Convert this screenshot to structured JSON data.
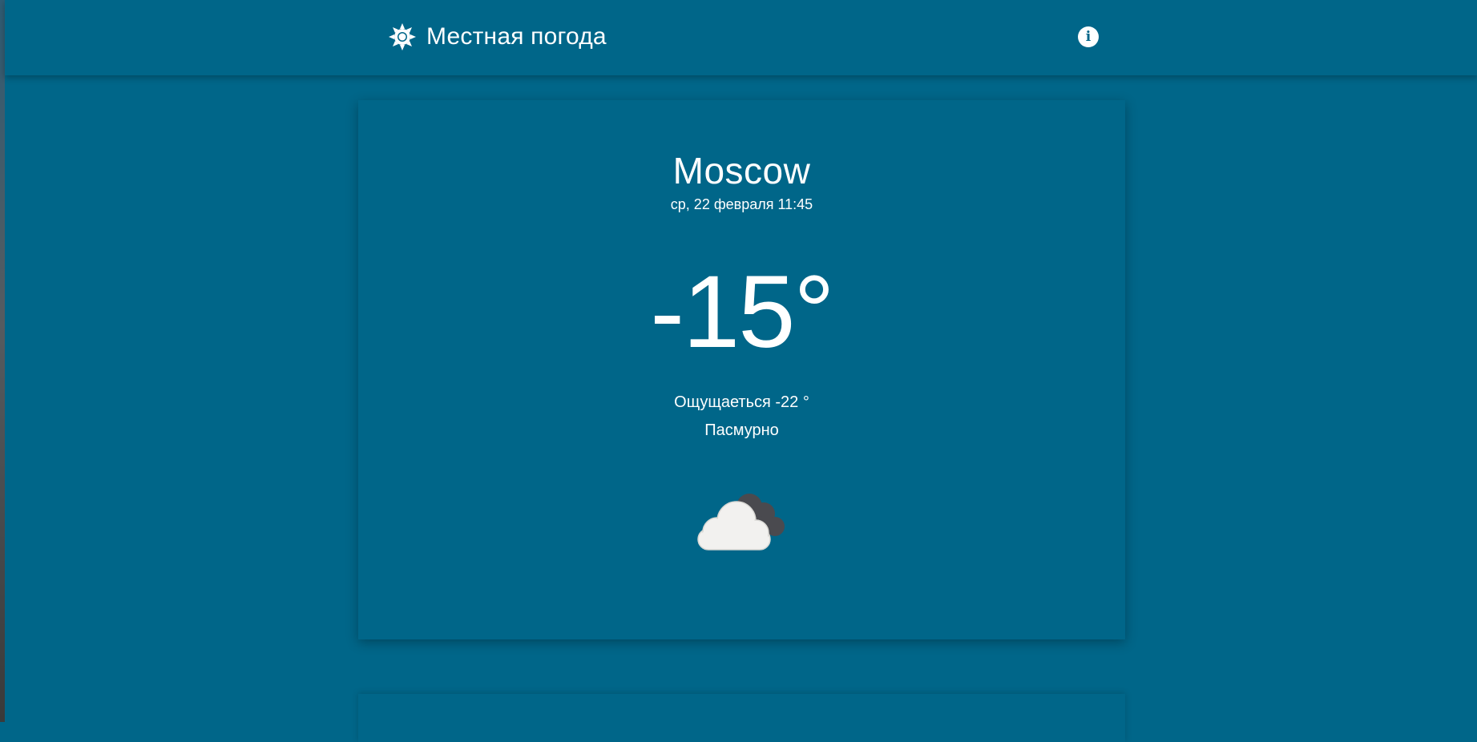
{
  "header": {
    "title": "Местная погода",
    "logo_icon": "sun-icon",
    "info_icon": "info-icon",
    "info_glyph": "i"
  },
  "weather": {
    "city": "Moscow",
    "datetime": "ср, 22 февраля 11:45",
    "temperature": "-15°",
    "feels_like": "Ощущаеться -22 °",
    "condition": "Пасмурно",
    "condition_icon": "overcast-clouds-icon"
  },
  "colors": {
    "background": "#006689",
    "text": "#ffffff",
    "cloud_light": "#f2f1ef",
    "cloud_dark": "#4a4a4f"
  }
}
